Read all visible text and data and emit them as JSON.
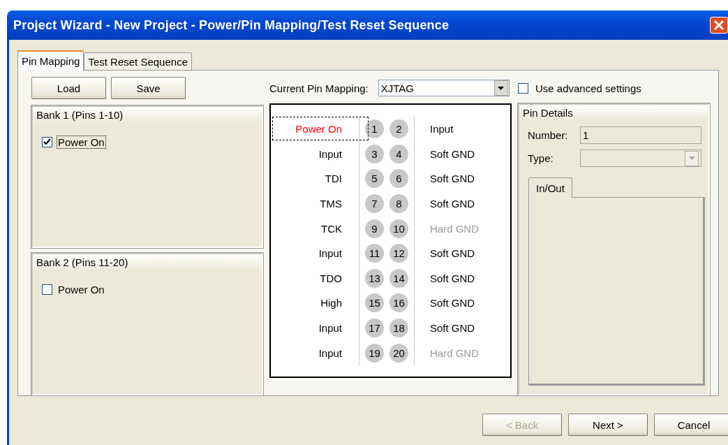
{
  "window": {
    "title": "Project Wizard - New Project - Power/Pin Mapping/Test Reset Sequence"
  },
  "tabs": [
    {
      "label": "Pin Mapping",
      "selected": true
    },
    {
      "label": "Test Reset Sequence",
      "selected": false
    }
  ],
  "file_buttons": [
    "Load",
    "Save"
  ],
  "banks": [
    {
      "title": "Bank 1 (Pins 1-10)",
      "option": "Power On",
      "checked": true,
      "focused": true
    },
    {
      "title": "Bank 2 (Pins 11-20)",
      "option": "Power On",
      "checked": false,
      "focused": false
    }
  ],
  "mapping": {
    "label": "Current Pin Mapping:",
    "value": "XJTAG"
  },
  "advanced": {
    "label": "Use advanced settings",
    "checked": false
  },
  "pins": [
    {
      "left": "Power On",
      "pins": [
        "1",
        "2"
      ],
      "right": "Input",
      "powered": true,
      "right_disabled": false,
      "selected": true
    },
    {
      "left": "Input",
      "pins": [
        "3",
        "4"
      ],
      "right": "Soft GND",
      "powered": false,
      "right_disabled": false,
      "selected": false
    },
    {
      "left": "TDI",
      "pins": [
        "5",
        "6"
      ],
      "right": "Soft GND",
      "powered": false,
      "right_disabled": false,
      "selected": false
    },
    {
      "left": "TMS",
      "pins": [
        "7",
        "8"
      ],
      "right": "Soft GND",
      "powered": false,
      "right_disabled": false,
      "selected": false
    },
    {
      "left": "TCK",
      "pins": [
        "9",
        "10"
      ],
      "right": "Hard GND",
      "powered": false,
      "right_disabled": true,
      "selected": false
    },
    {
      "left": "Input",
      "pins": [
        "11",
        "12"
      ],
      "right": "Soft GND",
      "powered": false,
      "right_disabled": false,
      "selected": false
    },
    {
      "left": "TDO",
      "pins": [
        "13",
        "14"
      ],
      "right": "Soft GND",
      "powered": false,
      "right_disabled": false,
      "selected": false
    },
    {
      "left": "High",
      "pins": [
        "15",
        "16"
      ],
      "right": "Soft GND",
      "powered": false,
      "right_disabled": false,
      "selected": false
    },
    {
      "left": "Input",
      "pins": [
        "17",
        "18"
      ],
      "right": "Soft GND",
      "powered": false,
      "right_disabled": false,
      "selected": false
    },
    {
      "left": "Input",
      "pins": [
        "19",
        "20"
      ],
      "right": "Hard GND",
      "powered": false,
      "right_disabled": true,
      "selected": false
    }
  ],
  "pin_details": {
    "title": "Pin Details",
    "number_label": "Number:",
    "number": "1",
    "type_label": "Type:",
    "tab": "In/Out"
  },
  "buttons": [
    {
      "label": "< Back",
      "disabled": true
    },
    {
      "label": "Next >",
      "disabled": false
    },
    {
      "label": "Cancel",
      "disabled": false
    }
  ]
}
